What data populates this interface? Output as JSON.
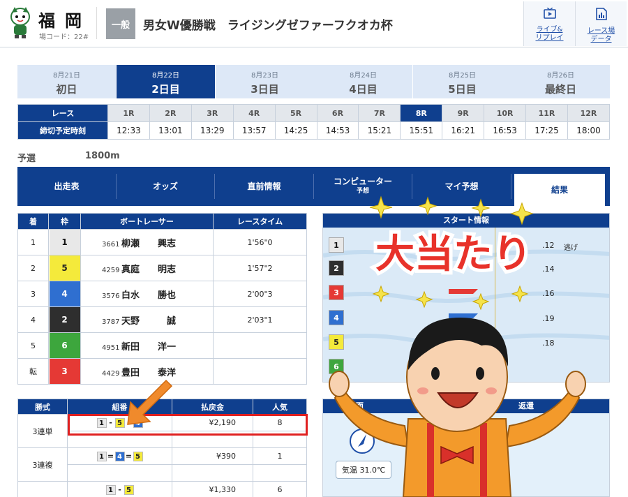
{
  "header": {
    "venue_name": "福岡",
    "venue_code": "場コード：22#",
    "grade": "一般",
    "race_title": "男女W優勝戦　ライジングゼファーフクオカ杯",
    "buttons": [
      {
        "label_line1": "ライブ&",
        "label_line2": "リプレイ",
        "icon": "tv-icon"
      },
      {
        "label_line1": "レース場",
        "label_line2": "データ",
        "icon": "chart-doc-icon"
      }
    ]
  },
  "days": [
    {
      "date": "8月21日",
      "name": "初日"
    },
    {
      "date": "8月22日",
      "name": "2日目"
    },
    {
      "date": "8月23日",
      "name": "3日目"
    },
    {
      "date": "8月24日",
      "name": "4日目"
    },
    {
      "date": "8月25日",
      "name": "5日目"
    },
    {
      "date": "8月26日",
      "name": "最終日"
    }
  ],
  "active_day_index": 1,
  "schedule": {
    "race_header": "レース",
    "time_header": "締切予定時刻",
    "races": [
      "1R",
      "2R",
      "3R",
      "4R",
      "5R",
      "6R",
      "7R",
      "8R",
      "9R",
      "10R",
      "11R",
      "12R"
    ],
    "times": [
      "12:33",
      "13:01",
      "13:29",
      "13:57",
      "14:25",
      "14:53",
      "15:21",
      "15:51",
      "16:21",
      "16:53",
      "17:25",
      "18:00"
    ],
    "active_race_index": 7
  },
  "race_info": {
    "type": "予選",
    "distance": "1800m"
  },
  "nav": [
    {
      "label": "出走表",
      "sub": ""
    },
    {
      "label": "オッズ",
      "sub": ""
    },
    {
      "label": "直前情報",
      "sub": ""
    },
    {
      "label": "コンピューター",
      "sub": "予想"
    },
    {
      "label": "マイ予想",
      "sub": ""
    },
    {
      "label": "結果",
      "sub": ""
    }
  ],
  "results": {
    "headers": [
      "着",
      "枠",
      "ボートレーサー",
      "レースタイム"
    ],
    "rows": [
      {
        "rank": "1",
        "lane": "1",
        "reg": "3661",
        "name": "柳瀬　　興志",
        "time": "1'56\"0"
      },
      {
        "rank": "2",
        "lane": "5",
        "reg": "4259",
        "name": "真庭　　明志",
        "time": "1'57\"2"
      },
      {
        "rank": "3",
        "lane": "4",
        "reg": "3576",
        "name": "白水　　勝也",
        "time": "2'00\"3"
      },
      {
        "rank": "4",
        "lane": "2",
        "reg": "3787",
        "name": "天野　　　誠",
        "time": "2'03\"1"
      },
      {
        "rank": "5",
        "lane": "6",
        "reg": "4951",
        "name": "新田　　洋一",
        "time": ""
      },
      {
        "rank": "転",
        "lane": "3",
        "reg": "4429",
        "name": "豊田　　泰洋",
        "time": ""
      }
    ]
  },
  "start_info": {
    "title": "スタート情報",
    "lanes": [
      "1",
      "2",
      "3",
      "4",
      "5",
      "6"
    ],
    "st": [
      ".12",
      ".14",
      ".16",
      ".19",
      ".18",
      ""
    ],
    "kimarite": "逃げ"
  },
  "payouts": {
    "headers": [
      "勝式",
      "組番",
      "払戻金",
      "人気"
    ],
    "rows": [
      {
        "type": "3連単",
        "combo": [
          "1",
          "5",
          "4"
        ],
        "seps": [
          "-",
          "-"
        ],
        "amount": "¥2,190",
        "pop": "8"
      },
      {
        "type": "3連複",
        "combo": [
          "1",
          "4",
          "5"
        ],
        "seps": [
          "=",
          "="
        ],
        "amount": "¥390",
        "pop": "1"
      },
      {
        "type": "",
        "combo": [
          "1",
          "5"
        ],
        "seps": [
          "-"
        ],
        "amount": "¥1,330",
        "pop": "6"
      }
    ]
  },
  "water": {
    "title_left": "水面",
    "title_right": "返還",
    "compass": "N",
    "temperature": "気温 31.0℃"
  },
  "overlay": {
    "text": "大当たり"
  },
  "colors": {
    "navy": "#0f3f8e",
    "lane1": "#e8e8e8",
    "lane2": "#2e2e2e",
    "lane3": "#e53935",
    "lane4": "#2f6fd0",
    "lane5": "#f4ea3b",
    "lane6": "#3da63d",
    "highlight": "#e02020",
    "arrow": "#f08a2c"
  }
}
